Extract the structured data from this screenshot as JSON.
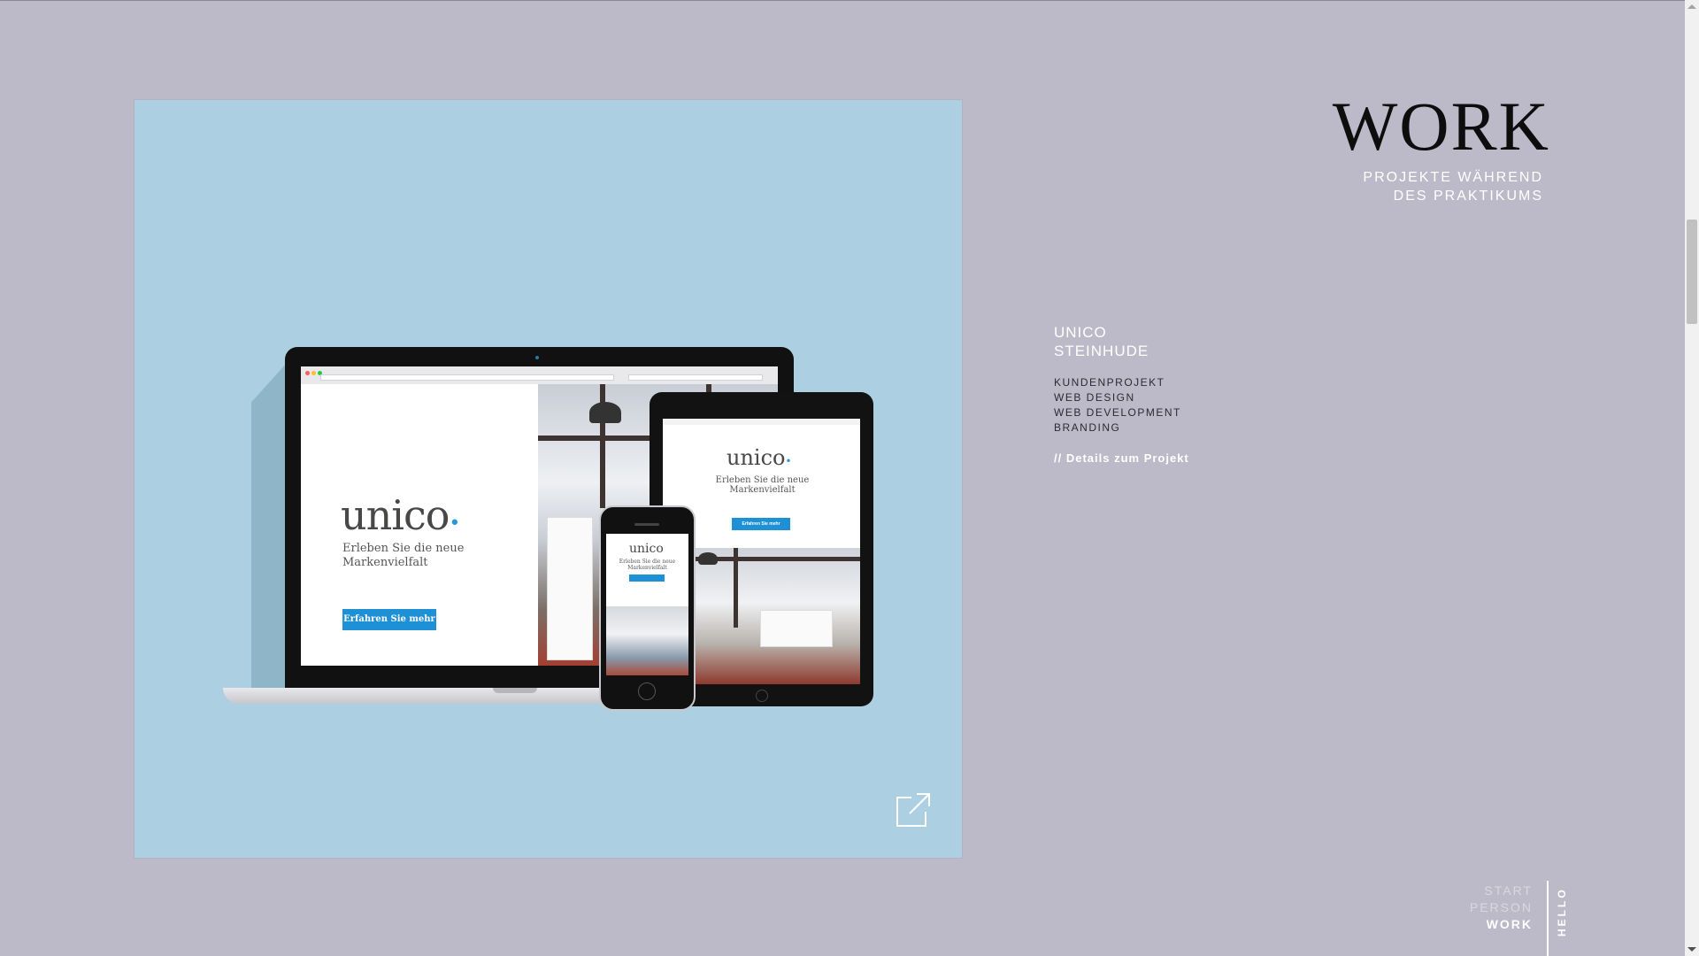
{
  "header": {
    "title": "WORK",
    "subtitle_line1": "PROJEKTE WÄHREND",
    "subtitle_line2": "DES PRAKTIKUMS"
  },
  "project": {
    "title_line1": "UNICO",
    "title_line2": "STEINHUDE",
    "tags": [
      "KUNDENPROJEKT",
      "WEB DESIGN",
      "WEB DEVELOPMENT",
      "BRANDING"
    ],
    "details_link": "// Details zum Projekt"
  },
  "mockup": {
    "background_color": "#acd0e1",
    "logo": "unico",
    "tagline_line1": "Erleben Sie die neue",
    "tagline_line2": "Markenvielfalt",
    "cta_label": "Erfahren Sie mehr",
    "accent_color": "#1e90d6",
    "external_link_icon": "external-link-icon"
  },
  "nav": {
    "items": [
      "START",
      "PERSON",
      "WORK"
    ],
    "active": "WORK",
    "side_label": "HELLO"
  },
  "colors": {
    "page_background": "#bcbac8",
    "heading": "#0d0d0d",
    "text_light": "#ffffff"
  }
}
